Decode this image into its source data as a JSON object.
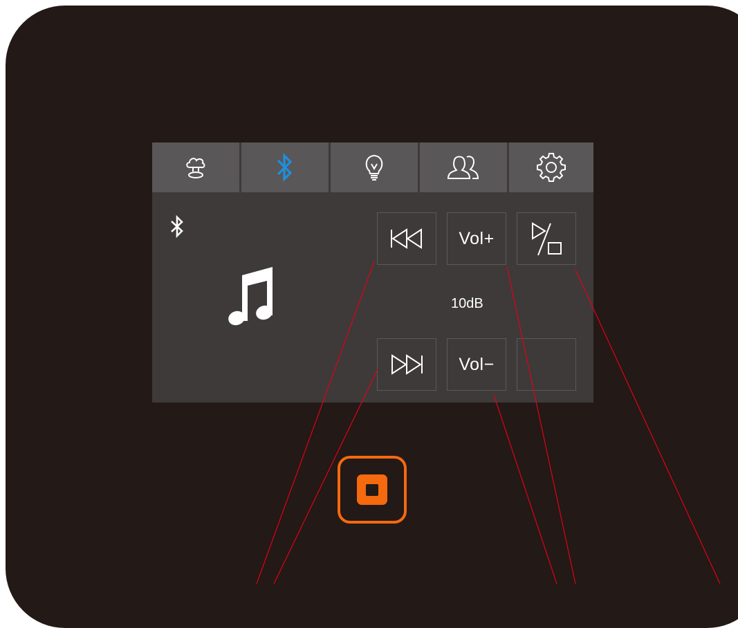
{
  "colors": {
    "device": "#231916",
    "screen": "#3d3a39",
    "tab_bg": "#595757",
    "accent_bluetooth": "#1e8fe0",
    "home_button": "#f5690f",
    "callout_lines": "#e2001a"
  },
  "tabs": [
    {
      "icon": "cloud-icon",
      "active": false
    },
    {
      "icon": "bluetooth-icon",
      "active": true
    },
    {
      "icon": "lightbulb-icon",
      "active": false
    },
    {
      "icon": "users-icon",
      "active": false
    },
    {
      "icon": "gear-icon",
      "active": false
    }
  ],
  "status": {
    "connection_icon": "bluetooth-icon",
    "media_icon": "music-note-icon"
  },
  "controls": {
    "previous_icon": "skip-previous-icon",
    "next_icon": "skip-next-icon",
    "vol_up_label": "Vol+",
    "vol_down_label": "Vol−",
    "play_stop_icon": "play-stop-icon",
    "volume_level": "10dB"
  },
  "home_button": {
    "icon": "stop-square-icon"
  }
}
